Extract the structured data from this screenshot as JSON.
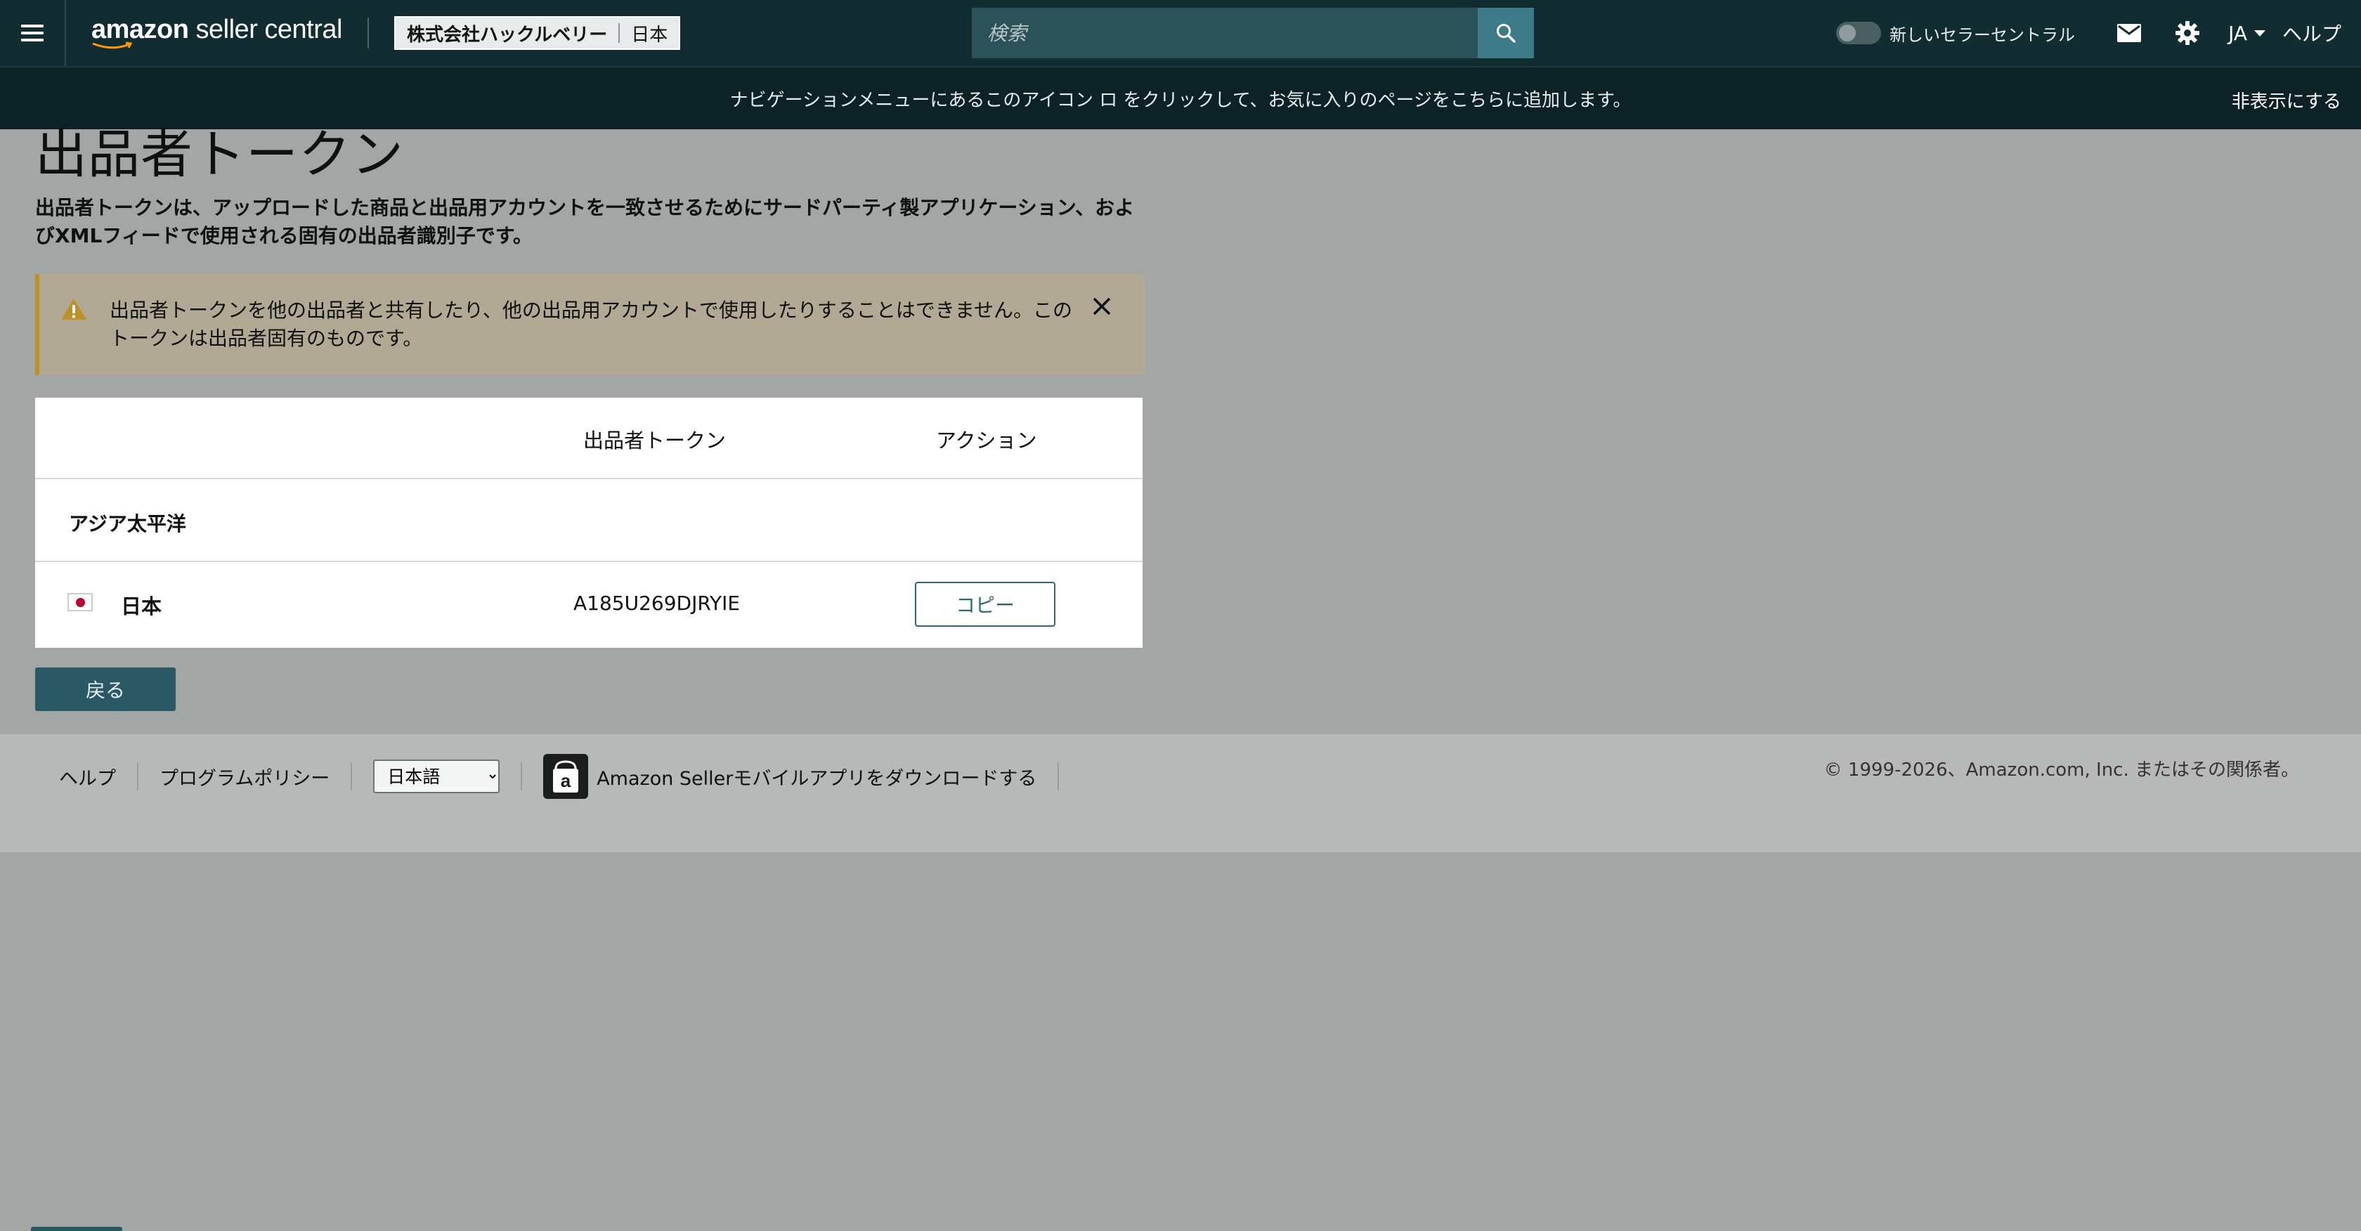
{
  "topbar": {
    "logo_text_bold": "amazon",
    "logo_text_rest": " seller central",
    "account_name": "株式会社ハックルベリー",
    "account_marketplace": "日本",
    "search_placeholder": "検索",
    "new_seller_central_label": "新しいセラーセントラル",
    "language": "JA",
    "help": "ヘルプ"
  },
  "announcement": {
    "text": "ナビゲーションメニューにあるこのアイコン ロ をクリックして、お気に入りのページをこちらに追加します。",
    "hide": "非表示にする"
  },
  "page": {
    "title": "出品者トークン",
    "description": "出品者トークンは、アップロードした商品と出品用アカウントを一致させるためにサードパーティ製アプリケーション、およびXMLフィードで使用される固有の出品者識別子です。"
  },
  "warning": {
    "text": "出品者トークンを他の出品者と共有したり、他の出品用アカウントで使用したりすることはできません。このトークンは出品者固有のものです。"
  },
  "table": {
    "col_token": "出品者トークン",
    "col_action": "アクション",
    "region": "アジア太平洋",
    "rows": [
      {
        "country": "日本",
        "token": "A185U269DJRYIE",
        "action": "コピー"
      }
    ]
  },
  "back_button": "戻る",
  "footer": {
    "help": "ヘルプ",
    "program_policy": "プログラムポリシー",
    "language_selected": "日本語",
    "app_download": "Amazon Sellerモバイルアプリをダウンロードする",
    "copyright": "© 1999-2026、Amazon.com, Inc. またはその関係者。"
  },
  "colors": {
    "topbar": "#112d31",
    "announce": "#0d2226",
    "accent": "#2c6a78",
    "warning_border": "#bf8f2a"
  }
}
